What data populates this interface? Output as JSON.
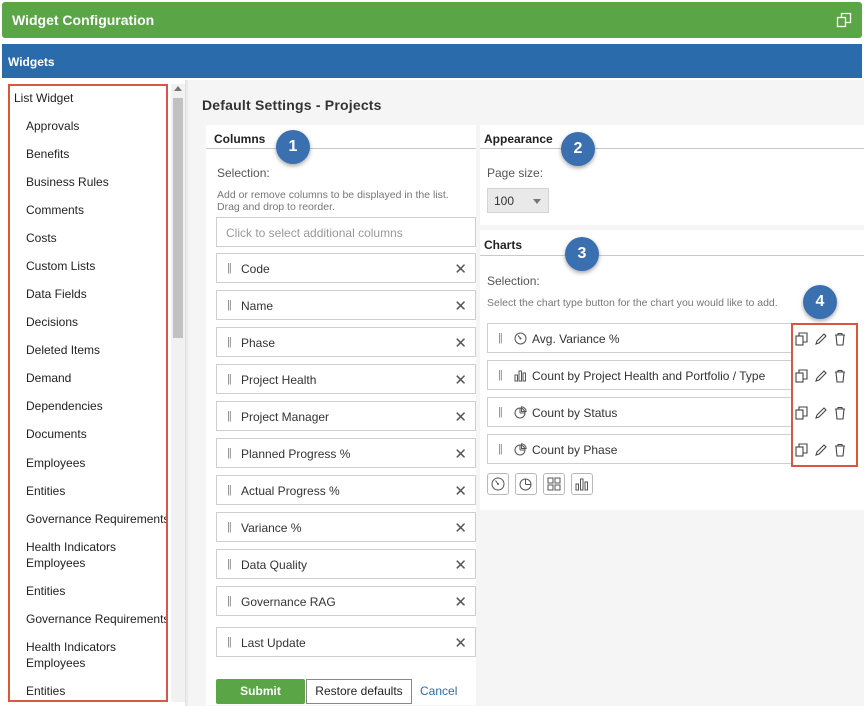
{
  "window": {
    "title": "Widget Configuration"
  },
  "header": {
    "title": "Widgets"
  },
  "sidebar": {
    "items": [
      {
        "label": "List Widget"
      },
      {
        "label": "Approvals"
      },
      {
        "label": "Benefits"
      },
      {
        "label": "Business Rules"
      },
      {
        "label": "Comments"
      },
      {
        "label": "Costs"
      },
      {
        "label": "Custom Lists"
      },
      {
        "label": "Data Fields"
      },
      {
        "label": "Decisions"
      },
      {
        "label": "Deleted Items"
      },
      {
        "label": "Demand"
      },
      {
        "label": "Dependencies"
      },
      {
        "label": "Documents"
      },
      {
        "label": "Employees"
      },
      {
        "label": "Entities"
      },
      {
        "label": "Governance Requirements"
      },
      {
        "label": "Health Indicators"
      },
      {
        "label": "Employees"
      },
      {
        "label": "Entities"
      },
      {
        "label": "Governance Requirements"
      },
      {
        "label": "Health Indicators"
      },
      {
        "label": "Employees"
      },
      {
        "label": "Entities"
      }
    ]
  },
  "main": {
    "title": "Default Settings - Projects",
    "columns": {
      "heading": "Columns",
      "badge": "1",
      "selection_label": "Selection:",
      "help_line1": "Add or remove columns to be displayed in the list.",
      "help_line2": "Drag and drop to reorder.",
      "placeholder": "Click to select additional columns",
      "items": [
        {
          "label": "Code"
        },
        {
          "label": "Name"
        },
        {
          "label": "Phase"
        },
        {
          "label": "Project Health"
        },
        {
          "label": "Project Manager"
        },
        {
          "label": "Planned Progress %"
        },
        {
          "label": "Actual Progress %"
        },
        {
          "label": "Variance %"
        },
        {
          "label": "Data Quality"
        },
        {
          "label": "Governance RAG"
        },
        {
          "label": "Last Update"
        }
      ]
    },
    "appearance": {
      "heading": "Appearance",
      "badge": "2",
      "page_size_label": "Page size:",
      "page_size_value": "100"
    },
    "charts": {
      "heading": "Charts",
      "badge": "3",
      "actions_badge": "4",
      "selection_label": "Selection:",
      "help": "Select the chart type button for the chart you would like to add.",
      "items": [
        {
          "label": "Avg. Variance %",
          "icon": "gauge-icon"
        },
        {
          "label": "Count by Project Health and Portfolio / Type",
          "icon": "bar-chart-icon"
        },
        {
          "label": "Count by Status",
          "icon": "pie-chart-icon"
        },
        {
          "label": "Count by Phase",
          "icon": "pie-chart-icon"
        }
      ]
    },
    "buttons": {
      "submit": "Submit",
      "restore": "Restore defaults",
      "cancel": "Cancel"
    }
  },
  "colors": {
    "title_bar": "#5aa545",
    "header_bar": "#2a6cab",
    "badge": "#3a6fb0",
    "highlight_border": "#d9573f",
    "submit_button": "#5aa545",
    "link": "#2a6cab"
  }
}
